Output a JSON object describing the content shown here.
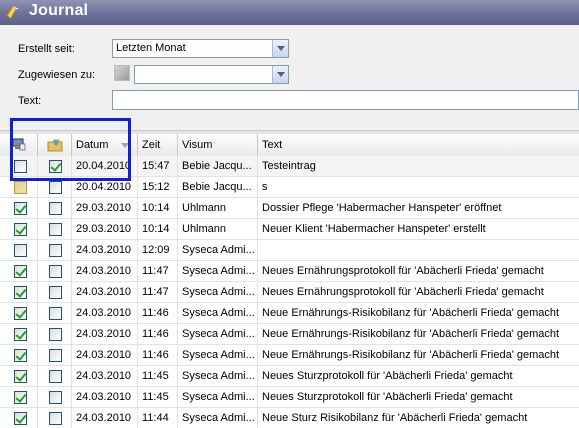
{
  "window": {
    "title": "Journal"
  },
  "filters": {
    "erstellt_label": "Erstellt seit:",
    "erstellt_value": "Letzten Monat",
    "zugewiesen_label": "Zugewiesen zu:",
    "zugewiesen_value": "",
    "text_label": "Text:",
    "text_value": ""
  },
  "columns": {
    "col1_icon": "monitor-icon",
    "col2_icon": "folder-icon",
    "datum": "Datum",
    "zeit": "Zeit",
    "visum": "Visum",
    "text": "Text"
  },
  "rows": [
    {
      "c1": false,
      "c2": true,
      "datum": "20.04.2010",
      "zeit": "15:47",
      "visum": "Bebie Jacqu...",
      "text": "Testeintrag",
      "tan": false
    },
    {
      "c1": false,
      "c2": false,
      "datum": "20.04.2010",
      "zeit": "15:12",
      "visum": "Bebie Jacqu...",
      "text": "s",
      "tan": true
    },
    {
      "c1": true,
      "c2": false,
      "datum": "29.03.2010",
      "zeit": "10:14",
      "visum": "Uhlmann",
      "text": "Dossier Pflege 'Habermacher Hanspeter' eröffnet",
      "tan": false
    },
    {
      "c1": true,
      "c2": false,
      "datum": "29.03.2010",
      "zeit": "10:14",
      "visum": "Uhlmann",
      "text": "Neuer Klient 'Habermacher Hanspeter' erstellt",
      "tan": false
    },
    {
      "c1": false,
      "c2": false,
      "datum": "24.03.2010",
      "zeit": "12:09",
      "visum": "Syseca Admi...",
      "text": "",
      "tan": false
    },
    {
      "c1": true,
      "c2": false,
      "datum": "24.03.2010",
      "zeit": "11:47",
      "visum": "Syseca Admi...",
      "text": "Neues Ernährungsprotokoll für 'Abächerli Frieda' gemacht",
      "tan": false
    },
    {
      "c1": true,
      "c2": false,
      "datum": "24.03.2010",
      "zeit": "11:47",
      "visum": "Syseca Admi...",
      "text": "Neues Ernährungsprotokoll für 'Abächerli Frieda' gemacht",
      "tan": false
    },
    {
      "c1": true,
      "c2": false,
      "datum": "24.03.2010",
      "zeit": "11:46",
      "visum": "Syseca Admi...",
      "text": "Neue Ernährungs-Risikobilanz für 'Abächerli Frieda' gemacht",
      "tan": false
    },
    {
      "c1": true,
      "c2": false,
      "datum": "24.03.2010",
      "zeit": "11:46",
      "visum": "Syseca Admi...",
      "text": "Neue Ernährungs-Risikobilanz für 'Abächerli Frieda' gemacht",
      "tan": false
    },
    {
      "c1": true,
      "c2": false,
      "datum": "24.03.2010",
      "zeit": "11:46",
      "visum": "Syseca Admi...",
      "text": "Neue Ernährungs-Risikobilanz für 'Abächerli Frieda' gemacht",
      "tan": false
    },
    {
      "c1": true,
      "c2": false,
      "datum": "24.03.2010",
      "zeit": "11:45",
      "visum": "Syseca Admi...",
      "text": "Neues Sturzprotokoll für 'Abächerli Frieda' gemacht",
      "tan": false
    },
    {
      "c1": true,
      "c2": false,
      "datum": "24.03.2010",
      "zeit": "11:45",
      "visum": "Syseca Admi...",
      "text": "Neues Sturzprotokoll für 'Abächerli Frieda' gemacht",
      "tan": false
    },
    {
      "c1": true,
      "c2": false,
      "datum": "24.03.2010",
      "zeit": "11:44",
      "visum": "Syseca Admi...",
      "text": "Neue Sturz Risikobilanz für 'Abächerli Frieda' gemacht",
      "tan": false
    }
  ],
  "colors": {
    "title_bar": "#6b7199",
    "check": "#21a121",
    "highlight_box": "#1020d8"
  }
}
